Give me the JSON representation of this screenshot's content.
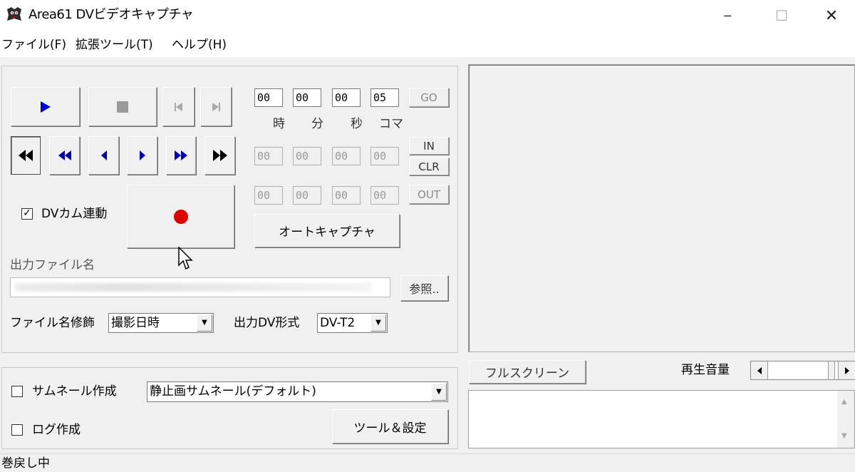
{
  "window": {
    "title": "Area61 DVビデオキャプチャ",
    "minimize_label": "─",
    "maximize_label": "☐",
    "close_label": "✕"
  },
  "menu": [
    "ファイル(F)",
    "拡張ツール(T)",
    "ヘルプ(H)"
  ],
  "timecode": {
    "goto": {
      "hours": "00",
      "minutes": "00",
      "seconds": "00",
      "frames": "05"
    },
    "units": [
      "時",
      "分",
      "秒",
      "コマ"
    ],
    "in": {
      "hours": "00",
      "minutes": "00",
      "seconds": "00",
      "frames": "00"
    },
    "out": {
      "hours": "00",
      "minutes": "00",
      "seconds": "00",
      "frames": "00"
    },
    "go_label": "GO",
    "in_label": "IN",
    "clr_label": "CLR",
    "out_label": "OUT"
  },
  "dvcam_link": {
    "label": "DVカム連動",
    "checked": true,
    "mark": "✓"
  },
  "auto_capture_label": "オートキャプチャ",
  "output": {
    "filename_label": "出力ファイル名",
    "browse_label": "参照..",
    "modifier_label": "ファイル名修飾",
    "modifier_value": "撮影日時",
    "format_label": "出力DV形式",
    "format_value": "DV-T2"
  },
  "options": {
    "thumbnail_label": "サムネール作成",
    "thumbnail_value": "静止画サムネール(デフォルト)",
    "log_label": "ログ作成",
    "tools_label": "ツール＆設定"
  },
  "preview": {
    "fullscreen_label": "フルスクリーン",
    "volume_label": "再生音量"
  },
  "status": "巻戻し中",
  "colors": {
    "play": "#0000cc",
    "record": "#e00000",
    "stop": "#9a9a9a"
  }
}
